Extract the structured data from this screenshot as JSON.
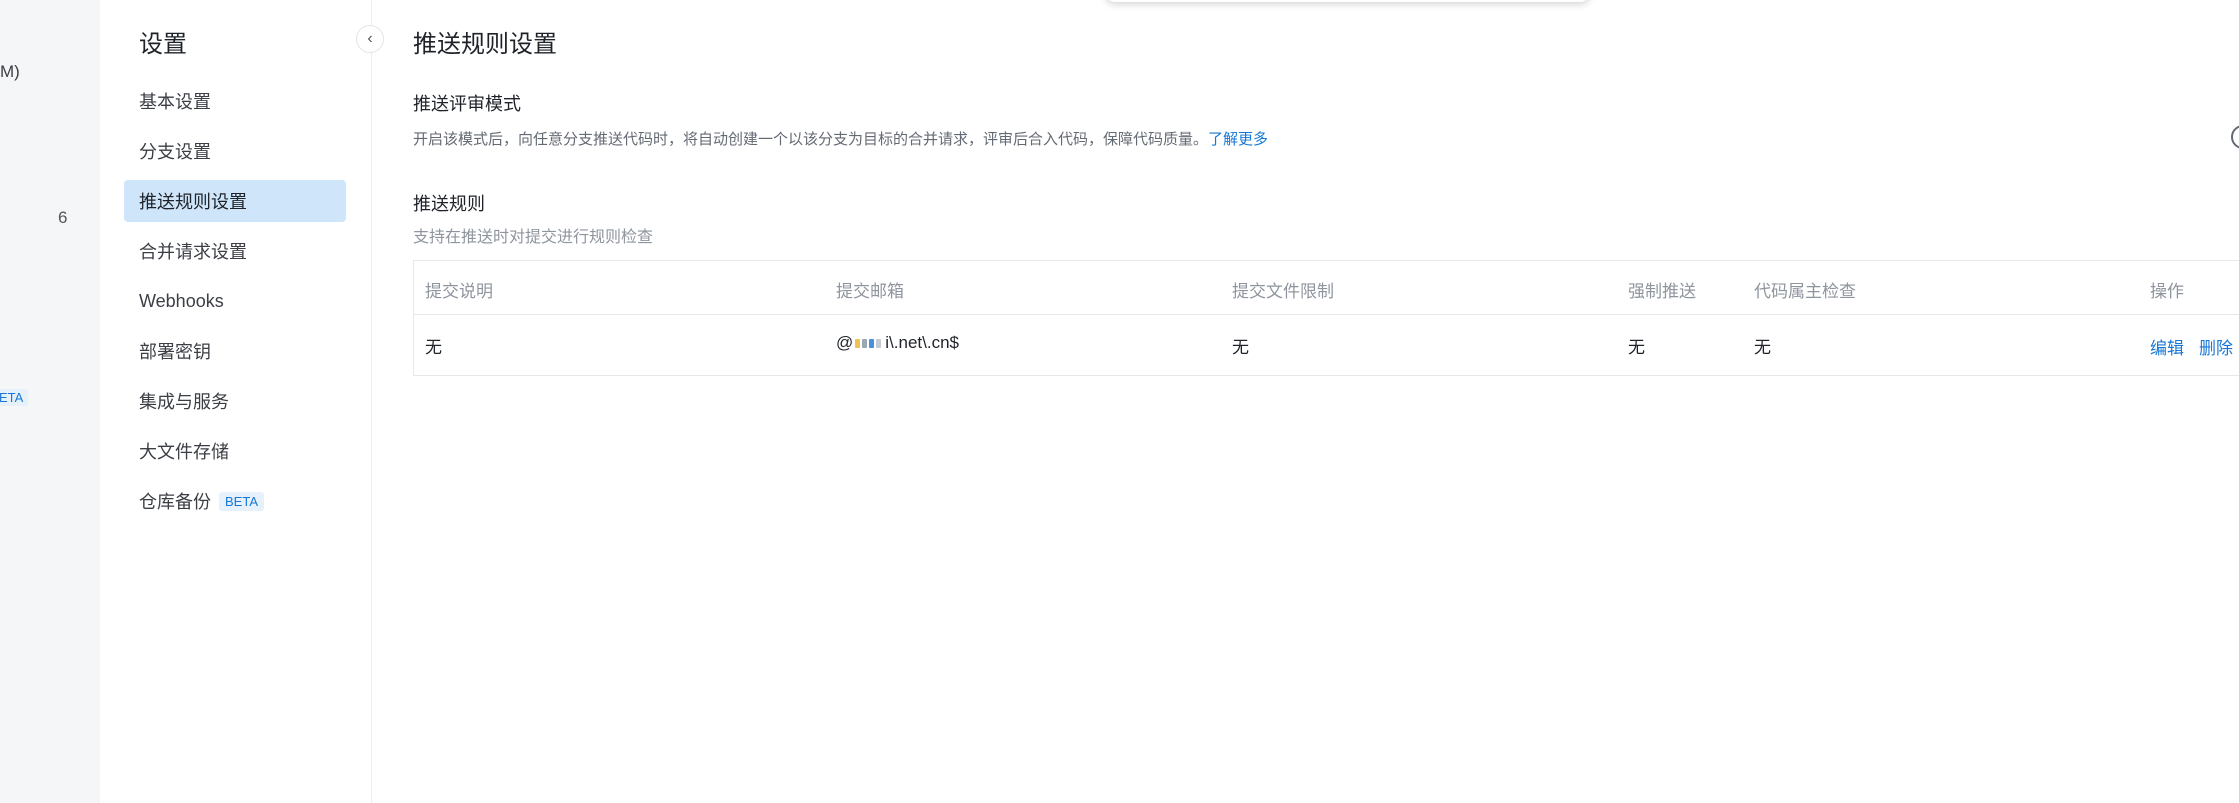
{
  "left_rail": {
    "label_1": "M)",
    "count": "6",
    "beta": "ETA"
  },
  "settings_nav": {
    "title": "设置",
    "collapse_icon": "chevron-left-icon",
    "items": [
      {
        "label": "基本设置"
      },
      {
        "label": "分支设置"
      },
      {
        "label": "推送规则设置",
        "active": true
      },
      {
        "label": "合并请求设置"
      },
      {
        "label": "Webhooks"
      },
      {
        "label": "部署密钥"
      },
      {
        "label": "集成与服务"
      },
      {
        "label": "大文件存储"
      },
      {
        "label": "仓库备份",
        "badge": "BETA"
      }
    ]
  },
  "main": {
    "page_title": "推送规则设置",
    "review_mode": {
      "title": "推送评审模式",
      "description": "开启该模式后，向任意分支推送代码时，将自动创建一个以该分支为目标的合并请求，评审后合入代码，保障代码质量。",
      "learn_more": "了解更多"
    },
    "push_rules": {
      "title": "推送规则",
      "subtitle": "支持在推送时对提交进行规则检查",
      "columns": [
        "提交说明",
        "提交邮箱",
        "提交文件限制",
        "强制推送",
        "代码属主检查",
        "操作"
      ],
      "rows": [
        {
          "commit_message": "无",
          "email_prefix": "@",
          "email_suffix": "i\\.net\\.cn$",
          "file_limit": "无",
          "force_push": "无",
          "code_owner": "无",
          "edit": "编辑",
          "delete": "删除"
        }
      ]
    }
  },
  "colors": {
    "accent": "#1677d6",
    "active_nav_bg": "#cfe6fa",
    "rail_bg": "#f5f6f7"
  }
}
